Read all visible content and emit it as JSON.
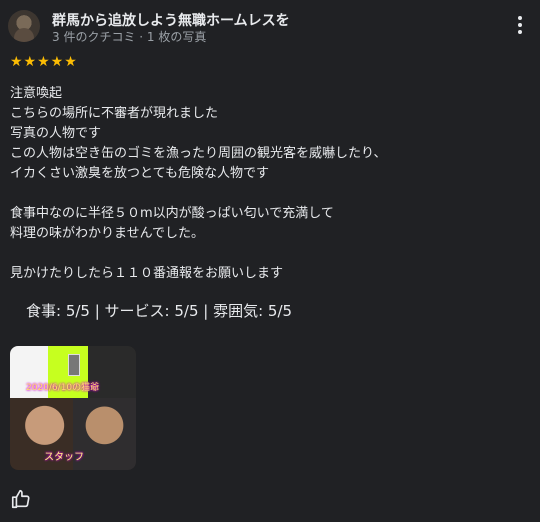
{
  "review": {
    "author_name": "群馬から追放しよう無職ホームレスを",
    "author_meta": "3 件のクチコミ · 1 枚の写真",
    "stars": "★★★★★",
    "lines": [
      "注意喚起",
      "こちらの場所に不審者が現れました",
      "写真の人物です",
      "この人物は空き缶のゴミを漁ったり周囲の観光客を威嚇したり、",
      "イカくさい激臭を放つとても危険な人物です",
      "",
      "食事中なのに半径５０m以内が酸っぱい匂いで充満して",
      "料理の味がわかりませんでした。",
      "",
      "見かけたりしたら１１０番通報をお願いします"
    ],
    "ratings": "食事: 5/5  |  サービス: 5/5  |  雰囲気: 5/5",
    "photo": {
      "date_text": "2020/6/10の猫爺",
      "caption": "スタッフ"
    }
  },
  "icons": {
    "more": "more-vert-icon",
    "like": "thumbs-up-icon"
  },
  "colors": {
    "background": "#202124",
    "star": "#fbbc04",
    "text": "#e8eaed",
    "secondary": "#9aa0a6"
  }
}
